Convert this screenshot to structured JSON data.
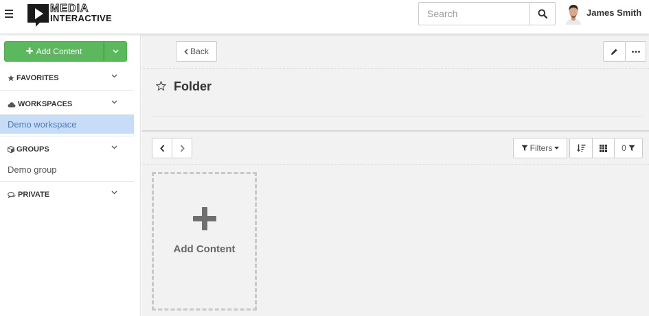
{
  "header": {
    "logo": {
      "line1": "MEDIA",
      "line2": "INTERACTIVE"
    },
    "search": {
      "placeholder": "Search"
    },
    "user": {
      "name": "James Smith"
    }
  },
  "sidebar": {
    "add_button": {
      "label": "Add Content"
    },
    "sections": [
      {
        "title": "FAVORITES",
        "icon": "star-icon",
        "items": []
      },
      {
        "title": "WORKSPACES",
        "icon": "cloud-icon",
        "items": [
          {
            "label": "Demo workspace",
            "active": true
          }
        ]
      },
      {
        "title": "GROUPS",
        "icon": "cube-icon",
        "items": [
          {
            "label": "Demo group",
            "active": false
          }
        ]
      },
      {
        "title": "PRIVATE",
        "icon": "comments-icon",
        "items": []
      }
    ]
  },
  "main": {
    "back_label": "Back",
    "folder_title": "Folder",
    "filters_label": "Filters",
    "filter_count": "0",
    "add_card_label": "Add Content"
  },
  "colors": {
    "accent_green": "#5cb85c",
    "active_item_bg": "#c7dcf7",
    "active_item_text": "#4a7ec2"
  }
}
